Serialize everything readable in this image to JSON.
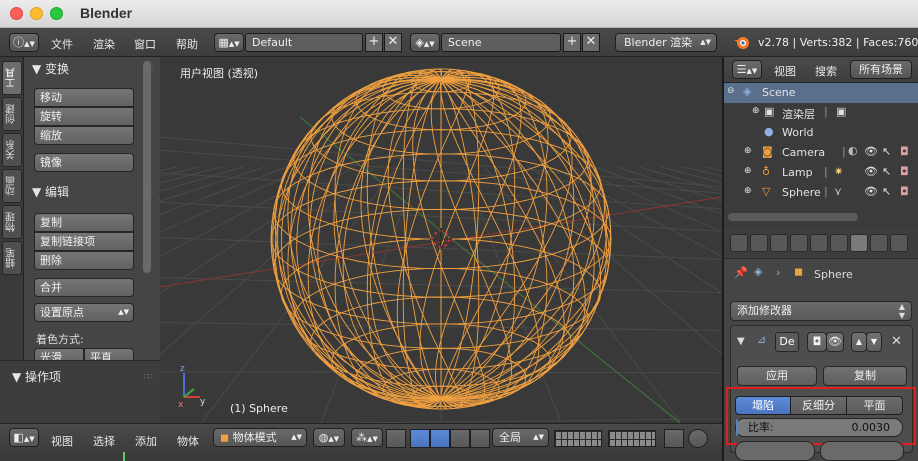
{
  "window": {
    "app_title": "Blender"
  },
  "info_header": {
    "menus": [
      "文件",
      "渲染",
      "窗口",
      "帮助"
    ],
    "screen_layout": "Default",
    "scene": "Scene",
    "render_engine": "Blender 渲染",
    "stats": "v2.78 | Verts:382 | Faces:760"
  },
  "left_tabs": [
    "工具",
    "创建",
    "关系",
    "动画",
    "物理",
    "蜡笔"
  ],
  "tool_shelf": {
    "transform_header": "▼ 变换",
    "transform_buttons": [
      "移动",
      "旋转",
      "缩放"
    ],
    "mirror_button": "镜像",
    "edit_header": "▼ 编辑",
    "edit_buttons": [
      "复制",
      "复制链接项",
      "删除"
    ],
    "join_button": "合并",
    "set_origin": "设置原点",
    "shading_label": "着色方式:",
    "shading_smooth": "光滑",
    "shading_flat": "平直"
  },
  "operator_panel": {
    "header": "▼ 操作项"
  },
  "viewport": {
    "view_label": "用户视图 (透视)",
    "object_label": "(1) Sphere",
    "wire_color": "#f0a040"
  },
  "outliner_header": {
    "view_menu": "视图",
    "search_menu": "搜索",
    "filter": "所有场景"
  },
  "outliner": {
    "scene": "Scene",
    "render_layers": "渲染层",
    "world": "World",
    "camera": "Camera",
    "lamp": "Lamp",
    "sphere": "Sphere"
  },
  "properties": {
    "breadcrumb_object": "Sphere",
    "add_modifier": "添加修改器",
    "modifier_name": "De",
    "apply_button": "应用",
    "copy_button": "复制",
    "modes": [
      "塌陷",
      "反细分",
      "平面"
    ],
    "active_mode": "塌陷",
    "ratio_label": "比率:",
    "ratio_value": "0.0030",
    "highlight_color": "#e02020",
    "active_color": "#5680d0"
  },
  "bottom_header": {
    "menus": [
      "视图",
      "选择",
      "添加",
      "物体"
    ],
    "mode": "物体模式",
    "pivot": "全局"
  }
}
